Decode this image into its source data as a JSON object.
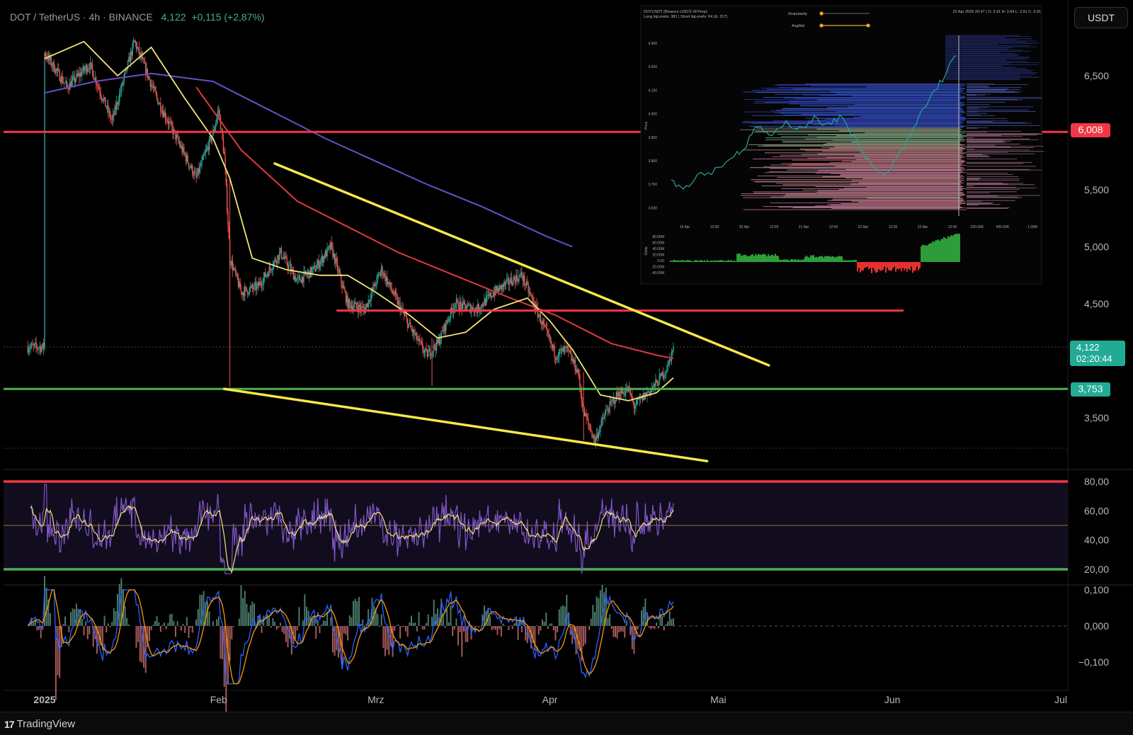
{
  "header": {
    "symbol": "DOT",
    "quote": "TetherUS",
    "interval": "4h",
    "exchange": "BINANCE",
    "separator": "·",
    "last": "4,122",
    "change": "+0,115 (+2,87%)"
  },
  "currency_button": "USDT",
  "branding": {
    "name": "TradingView",
    "mark": "17"
  },
  "price_labels": [
    {
      "text": "6,008",
      "color": "#f23645"
    },
    {
      "text": "3,753",
      "color": "#22ab94"
    }
  ],
  "current_price": {
    "price": "4,122",
    "countdown": "02:20:44",
    "color": "#22ab94"
  },
  "colors": {
    "resistance": "#f23645",
    "support": "#4caf50",
    "trendline": "#f6e84a",
    "candle_up": "#26a69a",
    "candle_down": "#ef5350",
    "sma_fast": "#f1e27a",
    "sma_mid": "#e0393e",
    "sma_slow": "#6a4fc4"
  },
  "chart_data": [
    {
      "type": "line",
      "name_hint": "price",
      "x_ticks": [
        "2025",
        "Feb",
        "Mrz",
        "Apr",
        "Mai",
        "Jun",
        "Jul"
      ],
      "y_ticks": [
        "6,500",
        "5,500",
        "5,000",
        "4,500",
        "3,500"
      ],
      "ylim": [
        3.1,
        6.95
      ],
      "price_path": [
        [
          "2025-01-01",
          6.7
        ],
        [
          "2025-01-05",
          6.4
        ],
        [
          "2025-01-09",
          6.6
        ],
        [
          "2025-01-13",
          6.1
        ],
        [
          "2025-01-17",
          6.8
        ],
        [
          "2025-01-21",
          6.3
        ],
        [
          "2025-01-25",
          5.9
        ],
        [
          "2025-01-28",
          5.6
        ],
        [
          "2025-01-31",
          6.0
        ],
        [
          "2025-02-01",
          6.2
        ],
        [
          "2025-02-02",
          5.8
        ],
        [
          "2025-02-03",
          4.9
        ],
        [
          "2025-02-05",
          4.6
        ],
        [
          "2025-02-08",
          4.65
        ],
        [
          "2025-02-12",
          4.95
        ],
        [
          "2025-02-15",
          4.7
        ],
        [
          "2025-02-18",
          4.8
        ],
        [
          "2025-02-21",
          5.0
        ],
        [
          "2025-02-24",
          4.5
        ],
        [
          "2025-02-27",
          4.45
        ],
        [
          "2025-03-02",
          4.8
        ],
        [
          "2025-03-04",
          4.6
        ],
        [
          "2025-03-07",
          4.3
        ],
        [
          "2025-03-10",
          4.05
        ],
        [
          "2025-03-12",
          4.15
        ],
        [
          "2025-03-15",
          4.5
        ],
        [
          "2025-03-19",
          4.45
        ],
        [
          "2025-03-22",
          4.6
        ],
        [
          "2025-03-25",
          4.7
        ],
        [
          "2025-03-27",
          4.75
        ],
        [
          "2025-03-30",
          4.4
        ],
        [
          "2025-04-02",
          4.05
        ],
        [
          "2025-04-04",
          4.1
        ],
        [
          "2025-04-06",
          3.9
        ],
        [
          "2025-04-07",
          3.55
        ],
        [
          "2025-04-09",
          3.3
        ],
        [
          "2025-04-11",
          3.55
        ],
        [
          "2025-04-13",
          3.7
        ],
        [
          "2025-04-15",
          3.75
        ],
        [
          "2025-04-16",
          3.6
        ],
        [
          "2025-04-18",
          3.7
        ],
        [
          "2025-04-20",
          3.8
        ],
        [
          "2025-04-22",
          3.95
        ],
        [
          "2025-04-23",
          4.12
        ]
      ],
      "sma_fast": [
        [
          "2025-01-01",
          6.65
        ],
        [
          "2025-01-08",
          6.8
        ],
        [
          "2025-01-14",
          6.5
        ],
        [
          "2025-01-20",
          6.75
        ],
        [
          "2025-01-26",
          6.3
        ],
        [
          "2025-01-31",
          5.95
        ],
        [
          "2025-02-03",
          5.6
        ],
        [
          "2025-02-07",
          4.9
        ],
        [
          "2025-02-13",
          4.8
        ],
        [
          "2025-02-19",
          4.75
        ],
        [
          "2025-02-24",
          4.75
        ],
        [
          "2025-03-01",
          4.6
        ],
        [
          "2025-03-07",
          4.4
        ],
        [
          "2025-03-12",
          4.2
        ],
        [
          "2025-03-17",
          4.25
        ],
        [
          "2025-03-22",
          4.45
        ],
        [
          "2025-03-28",
          4.55
        ],
        [
          "2025-04-01",
          4.35
        ],
        [
          "2025-04-05",
          4.1
        ],
        [
          "2025-04-10",
          3.7
        ],
        [
          "2025-04-15",
          3.65
        ],
        [
          "2025-04-20",
          3.72
        ],
        [
          "2025-04-23",
          3.85
        ]
      ],
      "sma_mid": [
        [
          "2025-01-28",
          6.4
        ],
        [
          "2025-02-05",
          5.85
        ],
        [
          "2025-02-15",
          5.4
        ],
        [
          "2025-02-25",
          5.15
        ],
        [
          "2025-03-05",
          4.95
        ],
        [
          "2025-03-15",
          4.75
        ],
        [
          "2025-03-25",
          4.55
        ],
        [
          "2025-04-02",
          4.4
        ],
        [
          "2025-04-12",
          4.15
        ],
        [
          "2025-04-20",
          4.05
        ],
        [
          "2025-04-23",
          4.02
        ]
      ],
      "sma_slow": [
        [
          "2025-01-01",
          6.35
        ],
        [
          "2025-01-10",
          6.45
        ],
        [
          "2025-01-20",
          6.52
        ],
        [
          "2025-01-31",
          6.45
        ],
        [
          "2025-02-10",
          6.2
        ],
        [
          "2025-02-20",
          5.95
        ],
        [
          "2025-03-01",
          5.75
        ],
        [
          "2025-03-10",
          5.55
        ],
        [
          "2025-03-20",
          5.35
        ],
        [
          "2025-03-31",
          5.1
        ],
        [
          "2025-04-05",
          5.0
        ]
      ],
      "horizontal_levels": [
        {
          "value": 6.008,
          "role": "resistance"
        },
        {
          "value": 4.44,
          "role": "resistance",
          "from": "2025-02-22",
          "to": "2025-06-03"
        },
        {
          "value": 3.753,
          "role": "support"
        }
      ],
      "trendlines": [
        {
          "from": [
            "2025-02-11",
            5.73
          ],
          "to": [
            "2025-05-10",
            3.96
          ]
        },
        {
          "from": [
            "2025-02-02",
            3.753
          ],
          "to": [
            "2025-04-29",
            3.12
          ]
        }
      ]
    },
    {
      "type": "line",
      "name_hint": "oscillator",
      "y_ticks": [
        "80,00",
        "60,00",
        "40,00",
        "20,00"
      ],
      "ylim": [
        10,
        90
      ],
      "upper_band": 80,
      "lower_band": 20,
      "midline": 50
    },
    {
      "type": "bar",
      "name_hint": "histogram oscillator",
      "y_ticks": [
        "0,100",
        "0,000",
        "−0,100"
      ],
      "ylim": [
        -0.18,
        0.11
      ]
    }
  ],
  "inset": {
    "header_lines": [
      "DOTUSDT (Binance USDⓈ-M Perp)",
      "Long liqLevels: 381 | Short liqLevels: 64 (Δ: 317)"
    ],
    "top_right": "22 Apr 2025 20:47 | O: 3.91 H: 3.94 L: 3.91 C: 3.91",
    "sliders": [
      "Granularity",
      "Avg/ital"
    ],
    "y_ticks": [
      "4.300",
      "4.200",
      "4.100",
      "4.000",
      "3.900",
      "3.800",
      "3.700",
      "3.600"
    ],
    "y_label": "Price",
    "x_ticks": [
      "19 Apr",
      "12:00",
      "20 Apr",
      "12:00",
      "21 Apr",
      "12:00",
      "22 Apr",
      "12:00",
      "23 Apr",
      "12:00"
    ],
    "volume_ticks": [
      "200.00K",
      "400.00K",
      "1.00M"
    ],
    "delta_ticks": [
      "80.00M",
      "60.00M",
      "40.00M",
      "20.00M",
      "0.00",
      "-20.00M",
      "-40.00M"
    ],
    "delta_label": "Delta"
  }
}
